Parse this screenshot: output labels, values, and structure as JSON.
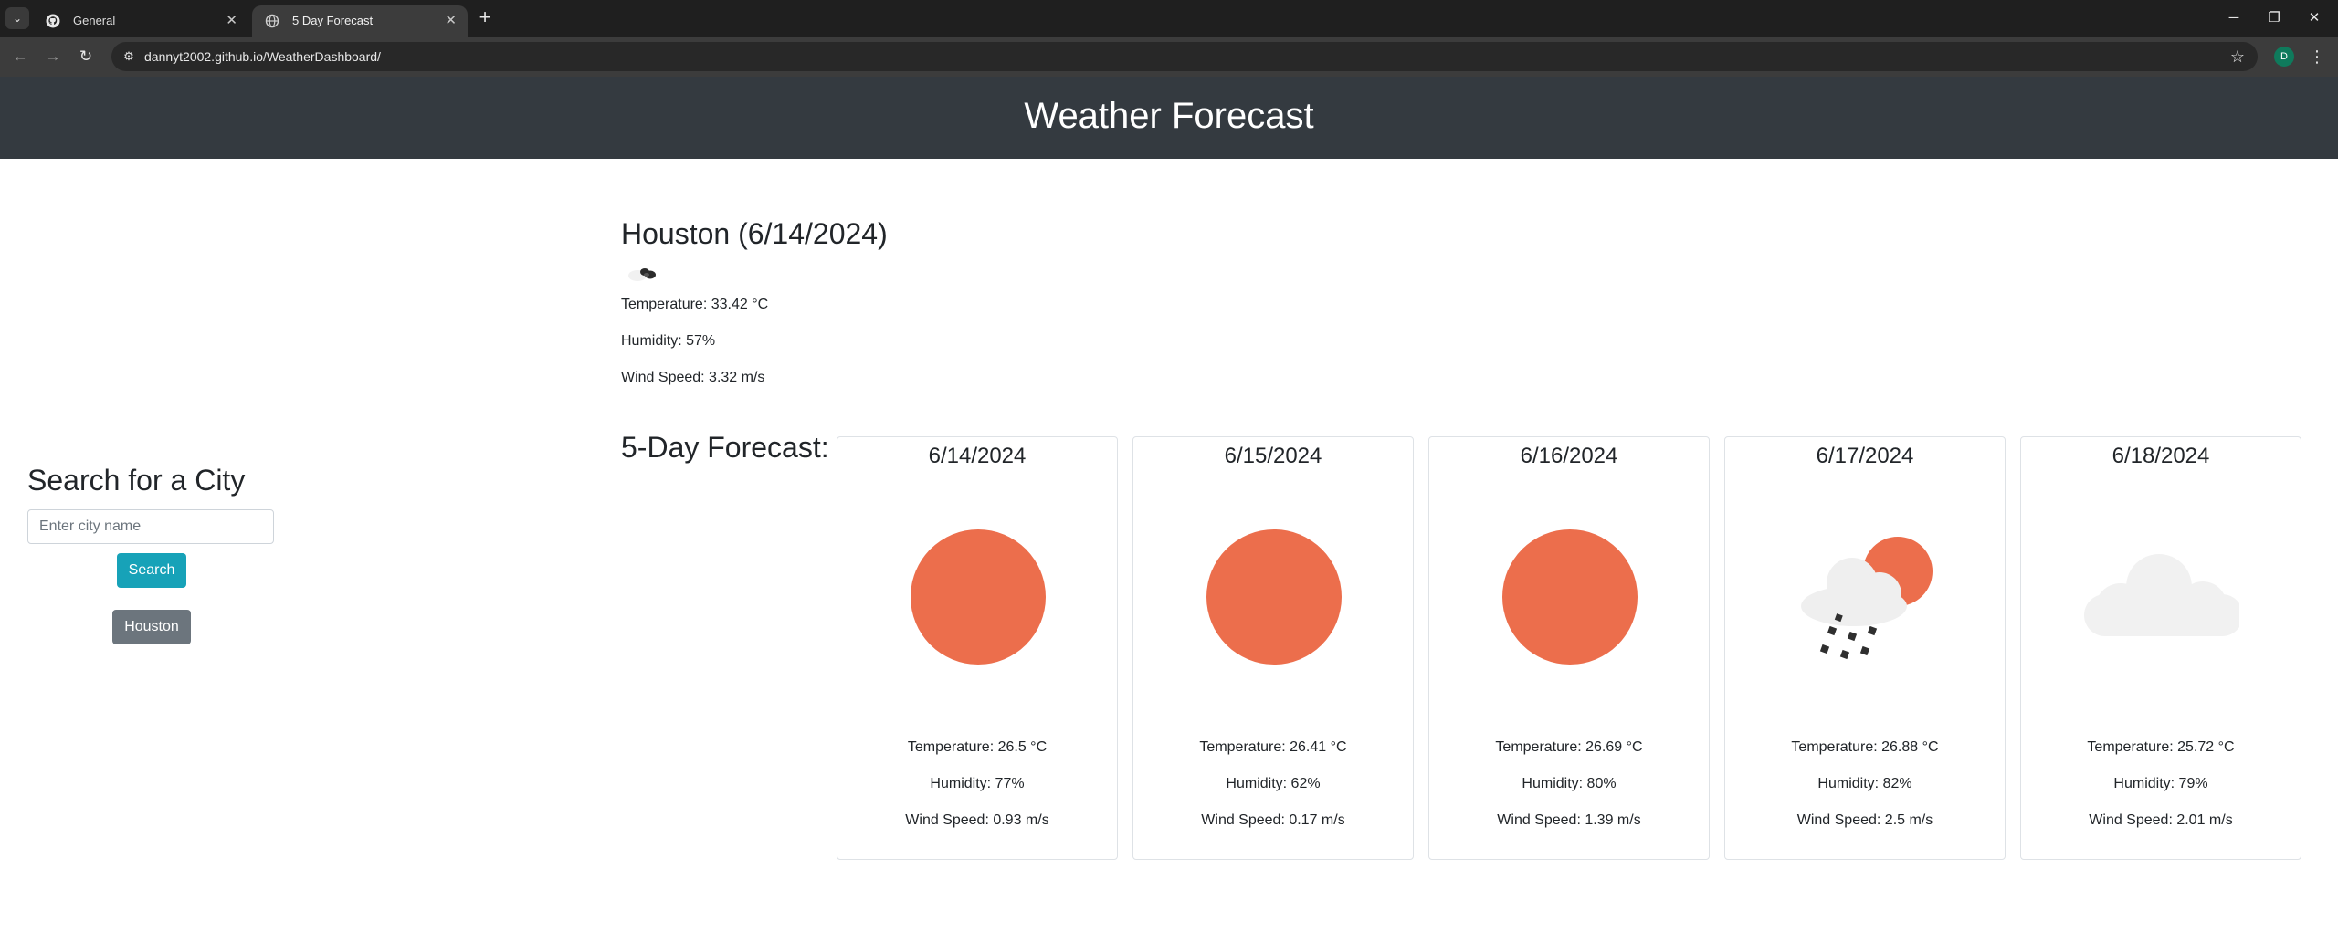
{
  "browser": {
    "tabs": [
      {
        "title": "General",
        "favicon": "github-icon"
      },
      {
        "title": "5 Day Forecast",
        "favicon": "globe-icon"
      }
    ],
    "url": "dannyt2002.github.io/WeatherDashboard/",
    "profile_initial": "D"
  },
  "header": {
    "title": "Weather Forecast"
  },
  "sidebar": {
    "title": "Search for a City",
    "search_placeholder": "Enter city name",
    "search_label": "Search",
    "history": [
      "Houston"
    ]
  },
  "current": {
    "heading": "Houston (6/14/2024)",
    "icon": "scattered-clouds-icon",
    "temperature": "Temperature: 33.42 °C",
    "humidity": "Humidity: 57%",
    "wind": "Wind Speed: 3.32 m/s"
  },
  "forecast": {
    "title": "5-Day Forecast:",
    "days": [
      {
        "date": "6/14/2024",
        "icon": "sun-icon",
        "temperature": "Temperature: 26.5 °C",
        "humidity": "Humidity: 77%",
        "wind": "Wind Speed: 0.93 m/s"
      },
      {
        "date": "6/15/2024",
        "icon": "sun-icon",
        "temperature": "Temperature: 26.41 °C",
        "humidity": "Humidity: 62%",
        "wind": "Wind Speed: 0.17 m/s"
      },
      {
        "date": "6/16/2024",
        "icon": "sun-icon",
        "temperature": "Temperature: 26.69 °C",
        "humidity": "Humidity: 80%",
        "wind": "Wind Speed: 1.39 m/s"
      },
      {
        "date": "6/17/2024",
        "icon": "rain-sun-cloud-icon",
        "temperature": "Temperature: 26.88 °C",
        "humidity": "Humidity: 82%",
        "wind": "Wind Speed: 2.5 m/s"
      },
      {
        "date": "6/18/2024",
        "icon": "cloud-icon",
        "temperature": "Temperature: 25.72 °C",
        "humidity": "Humidity: 79%",
        "wind": "Wind Speed: 2.01 m/s"
      }
    ]
  },
  "colors": {
    "header_bg": "#343a40",
    "search_button": "#17a2b8",
    "history_button": "#6c757d",
    "sun": "#ec6e4c",
    "cloud": "#f1f1f1"
  }
}
